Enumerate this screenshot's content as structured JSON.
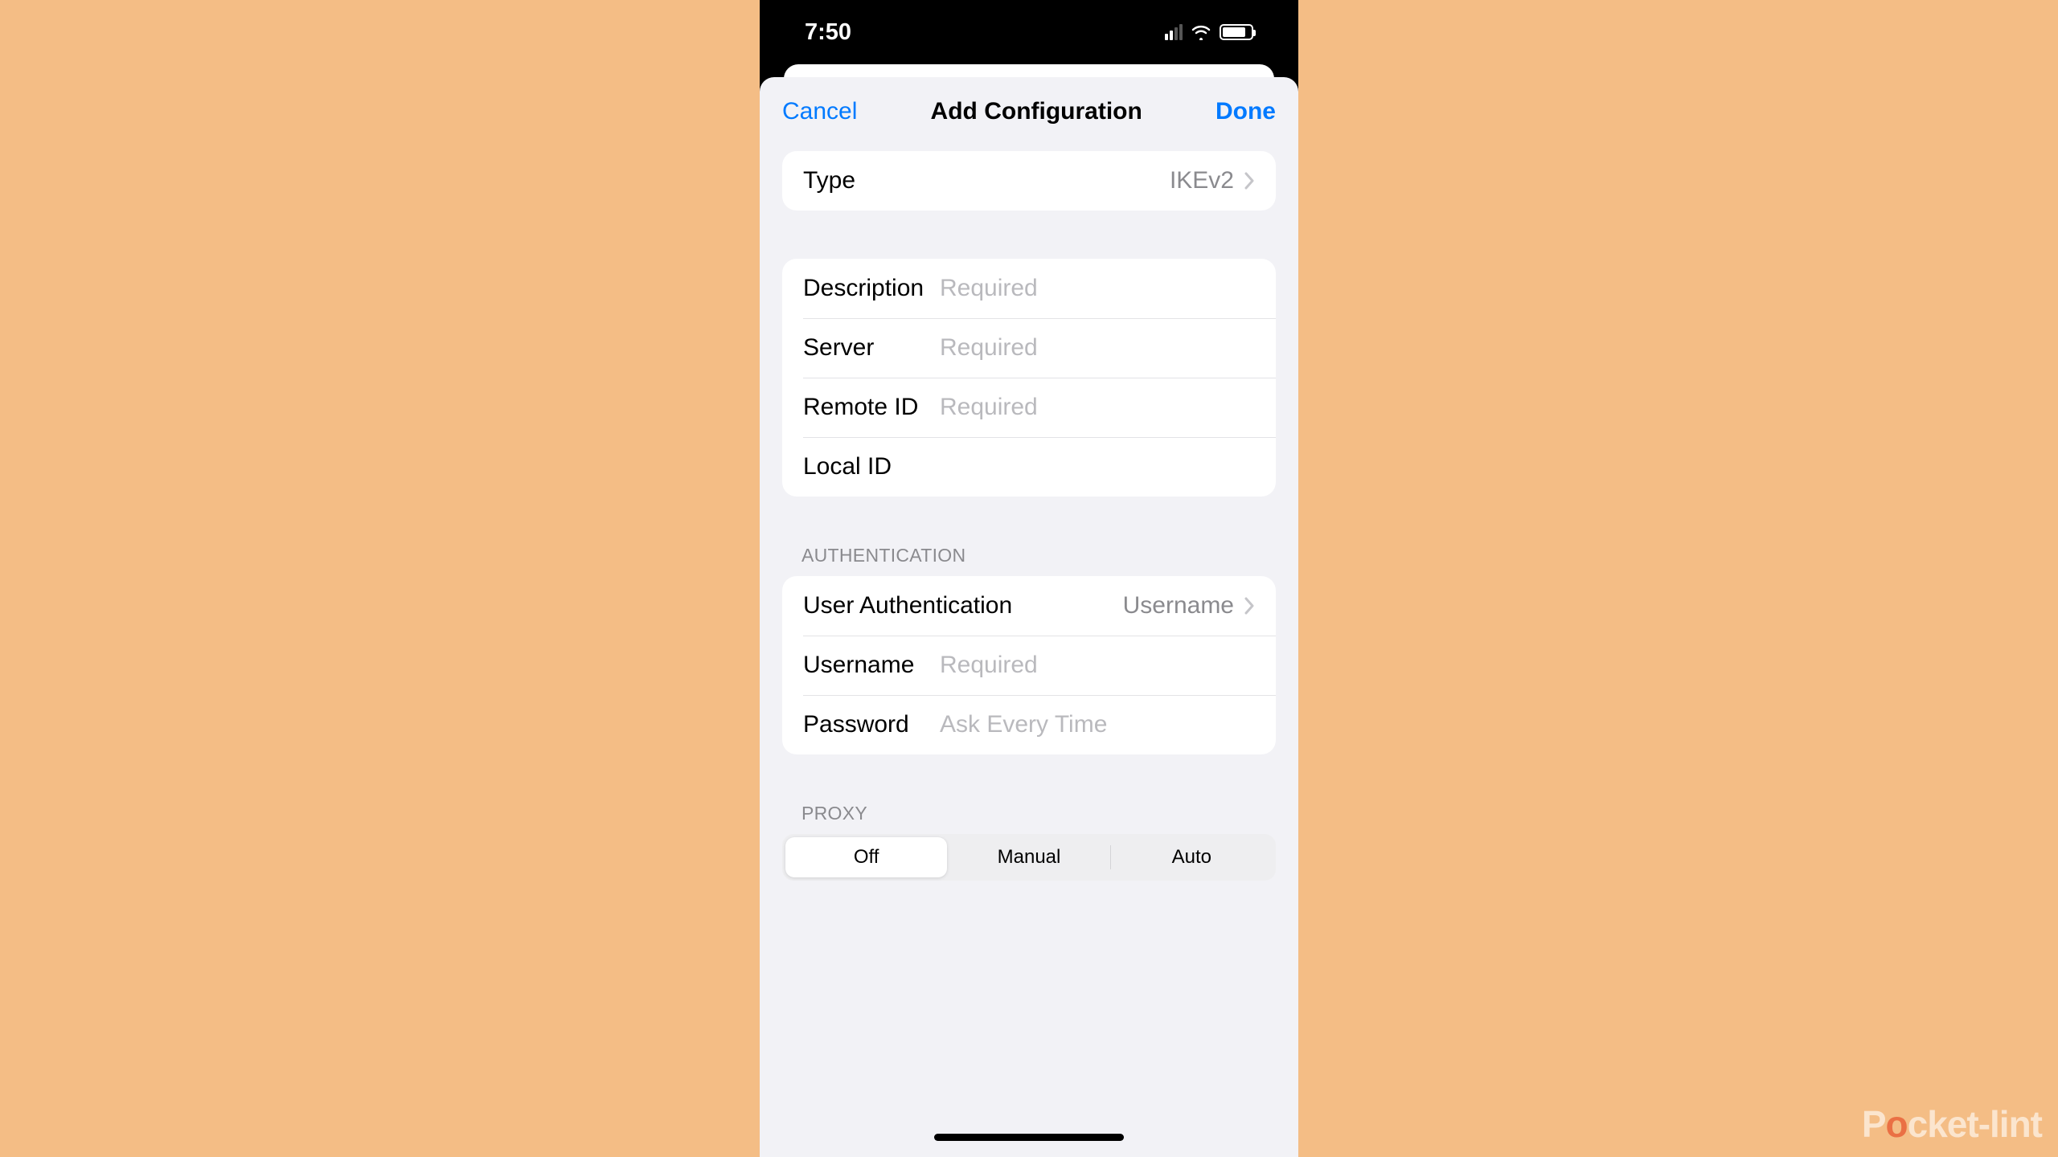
{
  "status": {
    "time": "7:50"
  },
  "nav": {
    "cancel": "Cancel",
    "title": "Add Configuration",
    "done": "Done"
  },
  "type_row": {
    "label": "Type",
    "value": "IKEv2"
  },
  "config": {
    "description_label": "Description",
    "description_placeholder": "Required",
    "server_label": "Server",
    "server_placeholder": "Required",
    "remote_id_label": "Remote ID",
    "remote_id_placeholder": "Required",
    "local_id_label": "Local ID",
    "local_id_placeholder": ""
  },
  "auth_header": "AUTHENTICATION",
  "auth": {
    "user_auth_label": "User Authentication",
    "user_auth_value": "Username",
    "username_label": "Username",
    "username_placeholder": "Required",
    "password_label": "Password",
    "password_placeholder": "Ask Every Time"
  },
  "proxy_header": "PROXY",
  "proxy": {
    "off": "Off",
    "manual": "Manual",
    "auto": "Auto"
  },
  "watermark": {
    "pre": "P",
    "o": "o",
    "post": "cket-lint"
  }
}
